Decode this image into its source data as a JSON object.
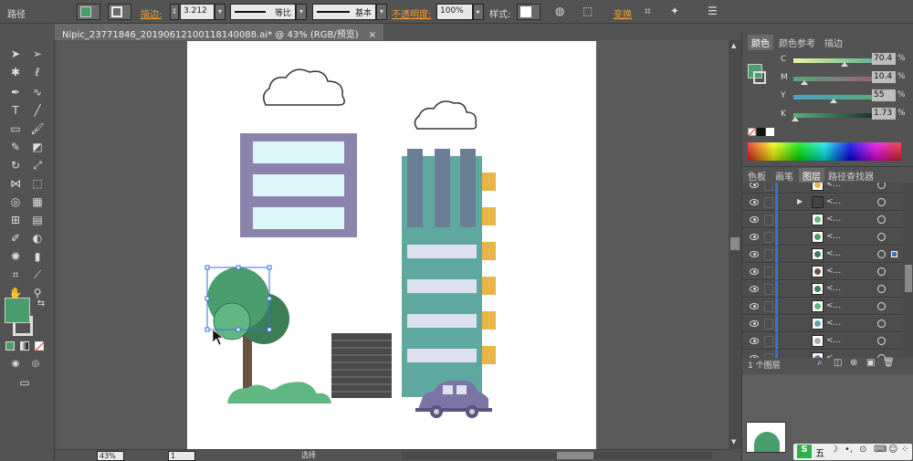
{
  "control_bar": {
    "object_type": "路径",
    "stroke_label": "描边:",
    "stroke_weight": "3.212",
    "stroke_profile": "等比",
    "brush": "基本",
    "opacity_label": "不透明度:",
    "opacity_value": "100%",
    "style_label": "样式:",
    "transform_label": "变换"
  },
  "document_tab": {
    "title": "Nipic_23771846_20190612100118140088.ai* @ 43% (RGB/预览)",
    "close": "×"
  },
  "status_bar": {
    "zoom": "43%",
    "artboard": "1",
    "tool_status": "选择"
  },
  "color_panel": {
    "tabs": [
      "颜色",
      "颜色参考",
      "描边"
    ],
    "channels": [
      {
        "name": "C",
        "value": "70.4"
      },
      {
        "name": "M",
        "value": "10.4"
      },
      {
        "name": "Y",
        "value": "55"
      },
      {
        "name": "K",
        "value": "1.73"
      }
    ],
    "pct_sign": "%"
  },
  "layers_panel": {
    "tabs": [
      "色板",
      "画笔",
      "图层",
      "路径查找器"
    ],
    "row_name": "<...",
    "footer": "1 个图层"
  },
  "colors": {
    "fill": "#4a9e6e",
    "accent_orange": "#f0a030",
    "building_purple": "#8a84ac",
    "window_blue": "#ddf6f8",
    "tower_teal": "#5fa8a0",
    "tower_slate": "#6a7e96",
    "window_lavender": "#dde1ee",
    "balcony_yellow": "#e8b548",
    "tree_green": "#4a9e6e",
    "tree_dark": "#3d7d55",
    "trunk": "#6a5240",
    "grille": "#4a4a4a",
    "car_purple": "#7c74a4",
    "selection_blue": "#3c6fd6"
  },
  "ime": {
    "label": "五"
  }
}
